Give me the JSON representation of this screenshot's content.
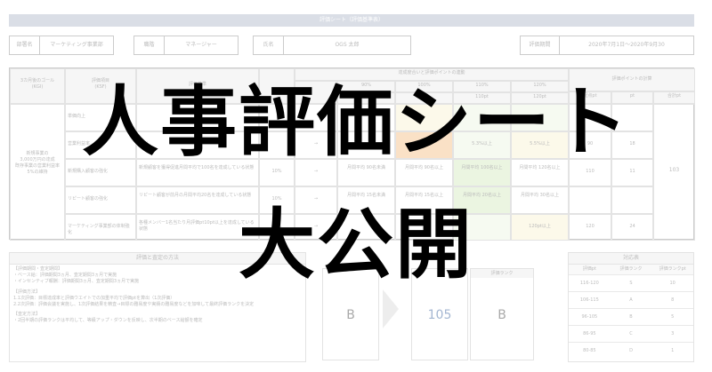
{
  "header": {
    "title": "評価シート（評価基準表）",
    "dept_label": "部署名",
    "dept_value": "マーケティング事業部",
    "grade_label": "職階",
    "grade_value": "マネージャー",
    "name_label": "氏名",
    "name_value": "OGS 太郎",
    "period_label": "評価期間",
    "period_value": "2020年7月1日〜2020年9月30"
  },
  "table": {
    "goal_header": "3カ月後のゴール",
    "goal_sub": "(KGI)",
    "item_header": "評価項目",
    "item_sub": "(KSF)",
    "criteria_header": "評価基準",
    "achievement_header": "達成度合いと評価ポイントの連動",
    "calc_header": "評価ポイントの計算",
    "levels": [
      "90%",
      "100%",
      "110%",
      "120%"
    ],
    "level_points": [
      "",
      "pt",
      "110pt",
      "120pt"
    ],
    "calc_cols": [
      "配点pt",
      "pt",
      "合計pt"
    ],
    "goal_text": [
      "新規事業の",
      "3,000万円の達成",
      "",
      "既存事業の営業利益率",
      "5%の維持"
    ],
    "rows": [
      {
        "item": "単価向上",
        "criteria": "",
        "weight": "",
        "arrow": "",
        "c1": "",
        "c2": "",
        "c3": "",
        "c4": "",
        "p1": "100",
        "p2": "",
        "highlight": ""
      },
      {
        "item": "営業利益率",
        "criteria": "20%",
        "weight": "",
        "arrow": "→",
        "c1": "",
        "c2": "",
        "c3": "5.3%以上",
        "c4": "5.5%以上",
        "p1": "90",
        "p2": "18",
        "highlight": "orange"
      },
      {
        "item": "新規購入顧客の強化",
        "criteria": "新規顧客を獲得促進月間平均で100名を達成している状態",
        "weight": "10%",
        "arrow": "→",
        "c1": "月間平均 90名未満",
        "c2": "月間平均 90名以上",
        "c3": "月間平均 100名以上",
        "c4": "月間平均 120名以上",
        "p1": "110",
        "p2": "11",
        "highlight": "green"
      },
      {
        "item": "リピート顧客の強化",
        "criteria": "リピート顧客が前月の月間平均20名を達成している状態",
        "weight": "10%",
        "arrow": "→",
        "c1": "月間平均 15名未満",
        "c2": "月間平均 15名以上",
        "c3": "月間平均 20名以上",
        "c4": "月間平均 30名以上",
        "p1": "",
        "p2": "",
        "highlight": "green"
      },
      {
        "item": "マーケティング事業部の体制強化",
        "criteria": "各種メンバー1名当たり月評価pt10pt以上を達成している状態",
        "weight": "20%",
        "arrow": "→",
        "c1": "",
        "c2": "",
        "c3": "",
        "c4": "120pt以上",
        "p1": "120",
        "p2": "24",
        "highlight": ""
      }
    ],
    "total": "103"
  },
  "method": {
    "title": "評価と査定の方法",
    "lines": [
      "【評価期間・査定期間】",
      "・ベース給：評価期間3ヵ月、査定期間3ヵ月で実施",
      "・インセンティブ報酬：評価期間3ヵ月、査定期間3ヵ月で実施",
      "",
      "【評価方法】",
      "1.1次評価：目標達成率と評価ウエイトでの加重平均で評価ptを算出（1次評価）",
      "2.2次評価：評価会議を実施し、1次評価結果を精査→目標の難易度や実績の難易度などを加味して最終評価ランクを決定",
      "",
      "【査定方法】",
      "・2回半期の評価ランクは平均して、等級アップ・ダウンを反映し、次半期のベース給額を確定"
    ]
  },
  "result": {
    "rank_header": "評価ランク",
    "rank1": "B",
    "points": "105",
    "rank2": "B"
  },
  "legend": {
    "title": "対応表",
    "headers": [
      "評価pt",
      "評価ランク",
      "評価ランクpt"
    ],
    "rows": [
      [
        "116-120",
        "S",
        "10"
      ],
      [
        "106-115",
        "A",
        "8"
      ],
      [
        "96-105",
        "B",
        "5"
      ],
      [
        "86-95",
        "C",
        "3"
      ],
      [
        "80-85",
        "D",
        "1"
      ]
    ]
  },
  "overlay": {
    "line1": "人事評価シート",
    "line2": "大公開"
  }
}
